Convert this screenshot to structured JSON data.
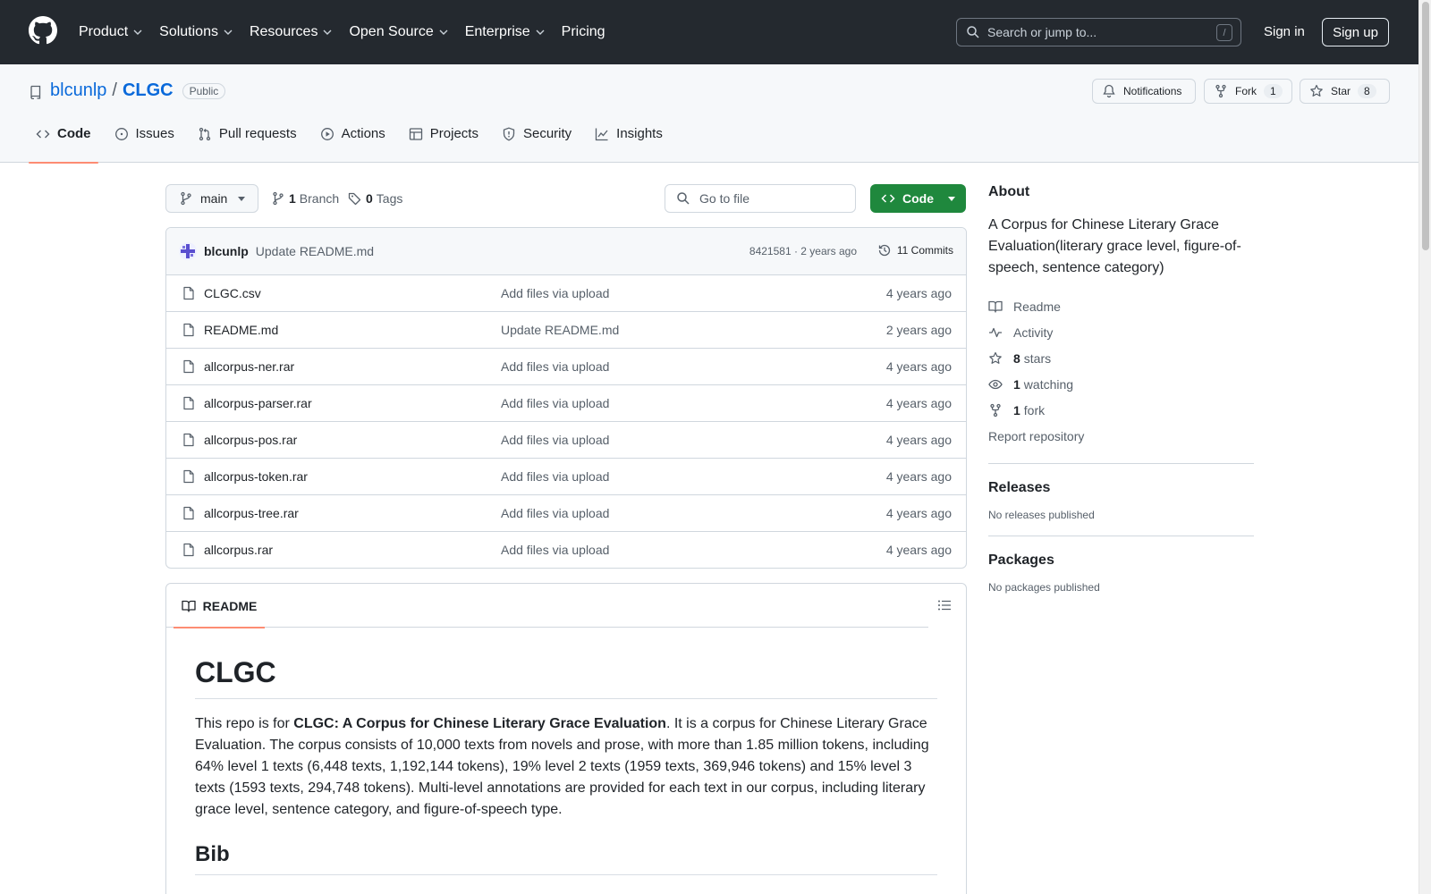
{
  "topnav": {
    "items": [
      "Product",
      "Solutions",
      "Resources",
      "Open Source",
      "Enterprise",
      "Pricing"
    ],
    "search_placeholder": "Search or jump to...",
    "search_shortcut": "/",
    "sign_in": "Sign in",
    "sign_up": "Sign up"
  },
  "repo": {
    "owner": "blcunlp",
    "separator": "/",
    "name": "CLGC",
    "visibility": "Public",
    "notifications_label": "Notifications",
    "fork_label": "Fork",
    "fork_count": "1",
    "star_label": "Star",
    "star_count": "8"
  },
  "tabs": [
    "Code",
    "Issues",
    "Pull requests",
    "Actions",
    "Projects",
    "Security",
    "Insights"
  ],
  "toolbar": {
    "branch": "main",
    "branch_count": "1",
    "branch_label": "Branch",
    "tag_count": "0",
    "tag_label": "Tags",
    "goto_placeholder": "Go to file",
    "code_button": "Code"
  },
  "commit": {
    "author": "blcunlp",
    "message": "Update README.md",
    "meta": "8421581 · 2 years ago",
    "commits": "11 Commits"
  },
  "files": [
    {
      "name": "CLGC.csv",
      "message": "Add files via upload",
      "age": "4 years ago"
    },
    {
      "name": "README.md",
      "message": "Update README.md",
      "age": "2 years ago"
    },
    {
      "name": "allcorpus-ner.rar",
      "message": "Add files via upload",
      "age": "4 years ago"
    },
    {
      "name": "allcorpus-parser.rar",
      "message": "Add files via upload",
      "age": "4 years ago"
    },
    {
      "name": "allcorpus-pos.rar",
      "message": "Add files via upload",
      "age": "4 years ago"
    },
    {
      "name": "allcorpus-token.rar",
      "message": "Add files via upload",
      "age": "4 years ago"
    },
    {
      "name": "allcorpus-tree.rar",
      "message": "Add files via upload",
      "age": "4 years ago"
    },
    {
      "name": "allcorpus.rar",
      "message": "Add files via upload",
      "age": "4 years ago"
    }
  ],
  "readme": {
    "tab": "README",
    "h1": "CLGC",
    "p_pre": "This repo is for ",
    "p_bold": "CLGC: A Corpus for Chinese Literary Grace Evaluation",
    "p_post": ". It is a corpus for Chinese Literary Grace Evaluation. The corpus consists of 10,000 texts from novels and prose, with more than 1.85 million tokens, including 64% level 1 texts (6,448 texts, 1,192,144 tokens), 19% level 2 texts (1959 texts, 369,946 tokens) and 15% level 3 texts (1593 texts, 294,748 tokens). Multi-level annotations are provided for each text in our corpus, including literary grace level, sentence category, and figure-of-speech type.",
    "h2": "Bib"
  },
  "sidebar": {
    "about_title": "About",
    "about_desc": "A Corpus for Chinese Literary Grace Evaluation(literary grace level, figure-of-speech, sentence category)",
    "readme": "Readme",
    "activity": "Activity",
    "stars_count": "8",
    "stars_label": "stars",
    "watching_count": "1",
    "watching_label": "watching",
    "fork_count": "1",
    "fork_label": "fork",
    "report": "Report repository",
    "releases_title": "Releases",
    "releases_empty": "No releases published",
    "packages_title": "Packages",
    "packages_empty": "No packages published"
  },
  "colors": {
    "header_bg": "#24292f",
    "link": "#0969da",
    "code_button": "#1f883d",
    "tab_underline": "#fd8c73"
  }
}
